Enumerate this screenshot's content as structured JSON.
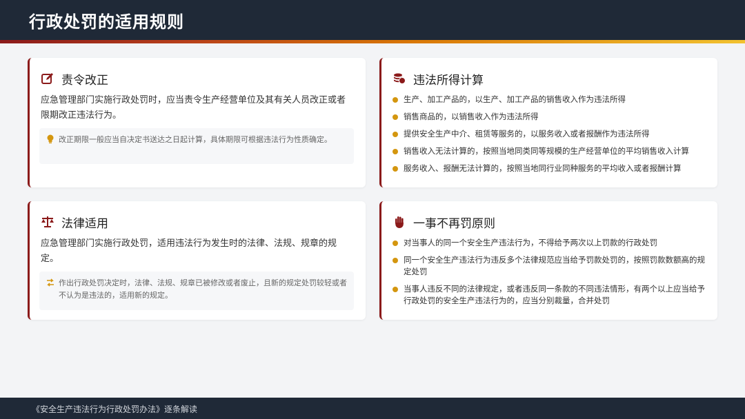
{
  "header": {
    "title": "行政处罚的适用规则"
  },
  "cards": {
    "correct": {
      "title": "责令改正",
      "desc": "应急管理部门实施行政处罚时，应当责令生产经营单位及其有关人员改正或者限期改正违法行为。",
      "note": "改正期限一般应当自决定书送达之日起计算，具体期限可根据违法行为性质确定。"
    },
    "income": {
      "title": "违法所得计算",
      "items": [
        "生产、加工产品的，以生产、加工产品的销售收入作为违法所得",
        "销售商品的，以销售收入作为违法所得",
        "提供安全生产中介、租赁等服务的，以服务收入或者报酬作为违法所得",
        "销售收入无法计算的，按照当地同类同等规模的生产经营单位的平均销售收入计算",
        "服务收入、报酬无法计算的，按照当地同行业同种服务的平均收入或者报酬计算"
      ]
    },
    "law": {
      "title": "法律适用",
      "desc": "应急管理部门实施行政处罚，适用违法行为发生时的法律、法规、规章的规定。",
      "note": "作出行政处罚决定时，法律、法规、规章已被修改或者废止，且新的规定处罚较轻或者不认为是违法的，适用新的规定。"
    },
    "once": {
      "title": "一事不再罚原则",
      "items": [
        "对当事人的同一个安全生产违法行为，不得给予两次以上罚款的行政处罚",
        "同一个安全生产违法行为违反多个法律规范应当给予罚款处罚的，按照罚款数额高的规定处罚",
        "当事人违反不同的法律规定，或者违反同一条款的不同违法情形，有两个以上应当给予行政处罚的安全生产违法行为的，应当分别裁量，合并处罚"
      ]
    }
  },
  "footer": {
    "text": "《安全生产违法行为行政处罚办法》逐条解读"
  },
  "colors": {
    "accent_red": "#8b1a1a",
    "bullet_gold": "#d4960f",
    "dark_bg": "#1f2937"
  }
}
